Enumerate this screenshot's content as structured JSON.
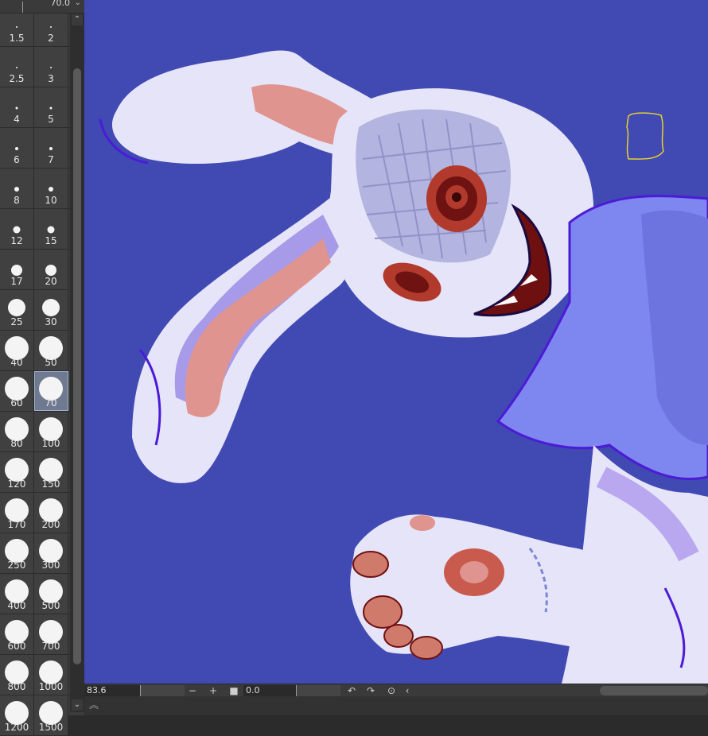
{
  "palette": {
    "current_size": "70.0",
    "selected": "70",
    "sizes": [
      [
        "1.5",
        "2"
      ],
      [
        "2.5",
        "3"
      ],
      [
        "4",
        "5"
      ],
      [
        "6",
        "7"
      ],
      [
        "8",
        "10"
      ],
      [
        "12",
        "15"
      ],
      [
        "17",
        "20"
      ],
      [
        "25",
        "30"
      ],
      [
        "40",
        "50"
      ],
      [
        "60",
        "70"
      ],
      [
        "80",
        "100"
      ],
      [
        "120",
        "150"
      ],
      [
        "170",
        "200"
      ],
      [
        "250",
        "300"
      ],
      [
        "400",
        "500"
      ],
      [
        "600",
        "700"
      ],
      [
        "800",
        "1000"
      ],
      [
        "1200",
        "1500"
      ]
    ]
  },
  "statusbar": {
    "zoom": "83.6",
    "rotation": "0.0",
    "zoom_out_icon": "minus-icon",
    "zoom_in_icon": "plus-icon",
    "fit_icon": "square-icon",
    "rotate_left_icon": "rotate-left-icon",
    "rotate_right_icon": "rotate-right-icon",
    "reset_rotation_icon": "reset-icon",
    "prev_icon": "chevron-left-icon"
  },
  "colors": {
    "canvas_bg": "#4149b3",
    "fur": "#e6e4f8",
    "ear_inner": "#e0948f",
    "eye": "#b23a2d",
    "mouth": "#6e0f10",
    "shirt": "#7e86ef",
    "outline": "#4b1bd6",
    "selection": "#e6d230"
  }
}
